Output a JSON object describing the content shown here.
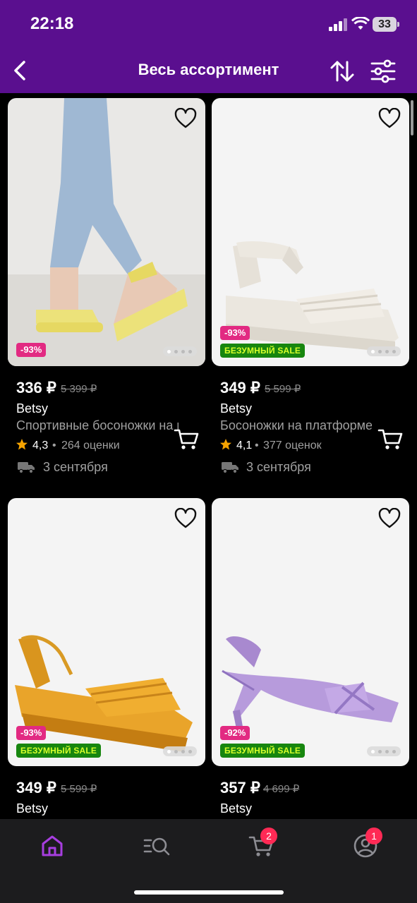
{
  "status": {
    "time": "22:18",
    "battery": "33"
  },
  "header": {
    "title": "Весь ассортимент"
  },
  "products": [
    {
      "price": "336 ₽",
      "old_price": "5 399 ₽",
      "brand": "Betsy",
      "name": "Спортивные босоножки на платформе",
      "rating": "4,3",
      "reviews": "264 оценки",
      "delivery": "3 сентября",
      "discount": "-93%",
      "sale_label": ""
    },
    {
      "price": "349 ₽",
      "old_price": "5 599 ₽",
      "brand": "Betsy",
      "name": "Босоножки на платформе",
      "rating": "4,1",
      "reviews": "377 оценок",
      "delivery": "3 сентября",
      "discount": "-93%",
      "sale_label": "БЕЗУМНЫЙ SALE"
    },
    {
      "price": "349 ₽",
      "old_price": "5 599 ₽",
      "brand": "Betsy",
      "discount": "-93%",
      "sale_label": "БЕЗУМНЫЙ SALE"
    },
    {
      "price": "357 ₽",
      "old_price": "4 699 ₽",
      "brand": "Betsy",
      "discount": "-92%",
      "sale_label": "БЕЗУМНЫЙ SALE"
    }
  ],
  "tabbar": {
    "cart_count": "2",
    "profile_count": "1"
  },
  "colors": {
    "header": "#5a0f8f",
    "discount": "#e22a82",
    "sale": "#17860f",
    "accent": "#a73ee0",
    "badge": "#ff2a55"
  }
}
